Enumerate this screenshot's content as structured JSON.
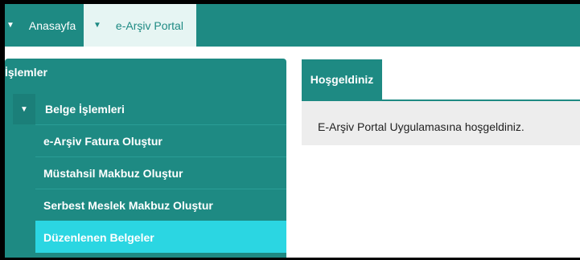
{
  "topnav": {
    "home_label": "Anasayfa",
    "portal_label": "e-Arşiv Portal"
  },
  "sidebar": {
    "header": "İşlemler",
    "group_label": "Belge İşlemleri",
    "items": [
      {
        "label": "e-Arşiv Fatura Oluştur"
      },
      {
        "label": "Müstahsil Makbuz Oluştur"
      },
      {
        "label": "Serbest Meslek Makbuz Oluştur"
      },
      {
        "label": "Düzenlenen Belgeler"
      }
    ]
  },
  "panel": {
    "tab_label": "Hoşgeldiniz",
    "message": "E-Arşiv Portal Uygulamasına hoşgeldiniz."
  },
  "colors": {
    "primary": "#1e8a83",
    "active_item": "#2bd6e2",
    "panel_bg": "#ededed"
  }
}
